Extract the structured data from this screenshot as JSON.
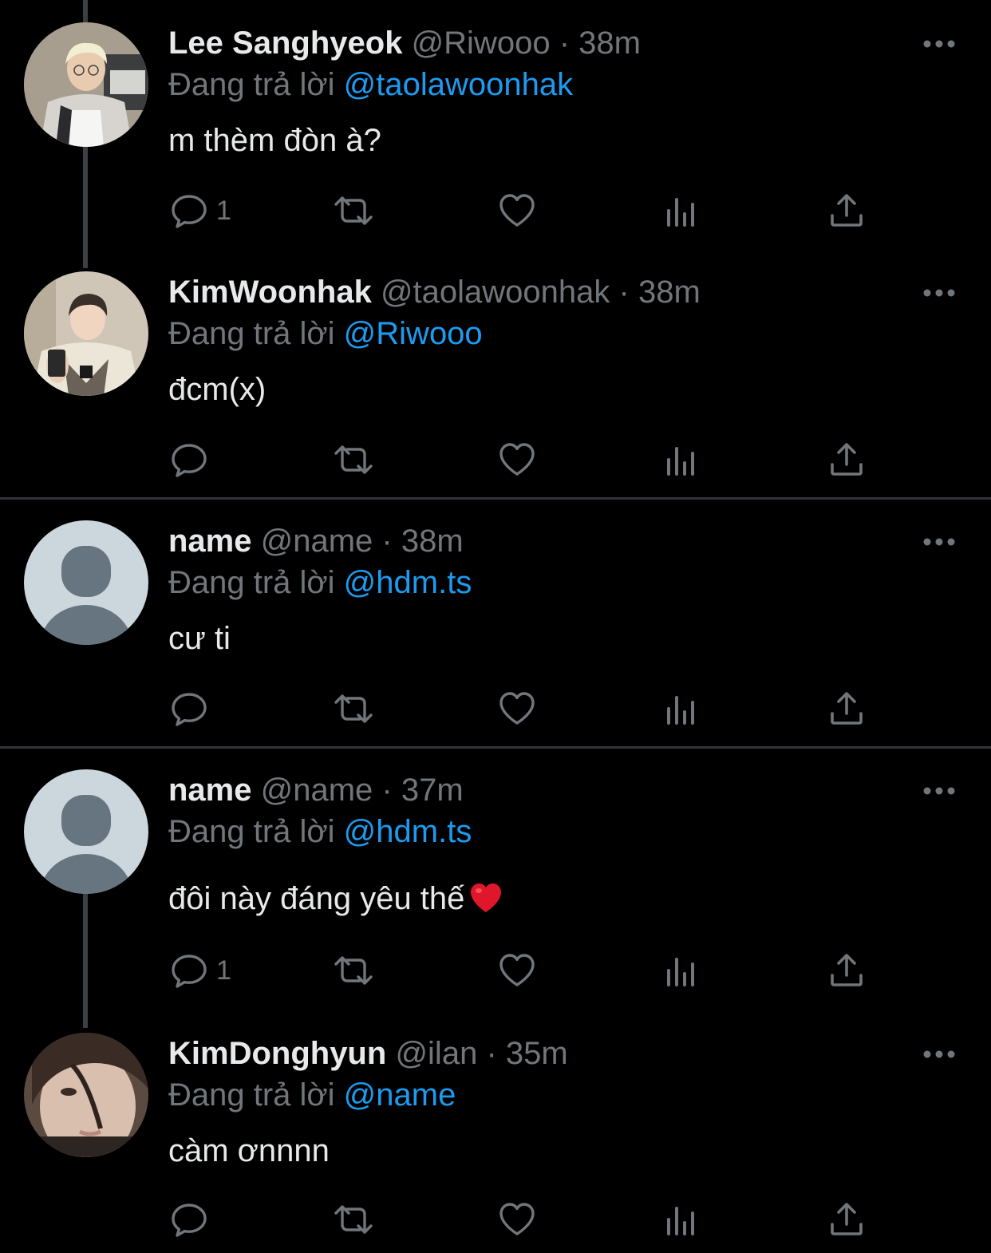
{
  "colors": {
    "background": "#000000",
    "text": "#e7e9ea",
    "muted": "#71767b",
    "accent": "#1d9bf0",
    "divider": "#2f3336"
  },
  "action_icons": [
    "reply-icon",
    "retweet-icon",
    "like-icon",
    "analytics-icon",
    "share-icon"
  ],
  "tweets": [
    {
      "display_name": "Lee Sanghyeok",
      "handle": "@Riwooo",
      "separator": "·",
      "time": "38m",
      "reply_prefix": "Đang trả lời",
      "reply_to": "@taolawoonhak",
      "text": "m thèm đòn à?",
      "reply_count": "1"
    },
    {
      "display_name": "KimWoonhak",
      "handle": "@taolawoonhak",
      "separator": "·",
      "time": "38m",
      "reply_prefix": "Đang trả lời",
      "reply_to": "@Riwooo",
      "text": "đcm(x)",
      "reply_count": ""
    },
    {
      "display_name": "name",
      "handle": "@name",
      "separator": "·",
      "time": "38m",
      "reply_prefix": "Đang trả lời",
      "reply_to": "@hdm.ts",
      "text": "cư ti",
      "reply_count": ""
    },
    {
      "display_name": "name",
      "handle": "@name",
      "separator": "·",
      "time": "37m",
      "reply_prefix": "Đang trả lời",
      "reply_to": "@hdm.ts",
      "text": "đôi này đáng yêu thế",
      "emoji": "red-heart-emoji",
      "reply_count": "1"
    },
    {
      "display_name": "KimDonghyun",
      "handle": "@ilan",
      "separator": "·",
      "time": "35m",
      "reply_prefix": "Đang trả lời",
      "reply_to": "@name",
      "text": "càm ơnnnn",
      "reply_count": ""
    }
  ]
}
